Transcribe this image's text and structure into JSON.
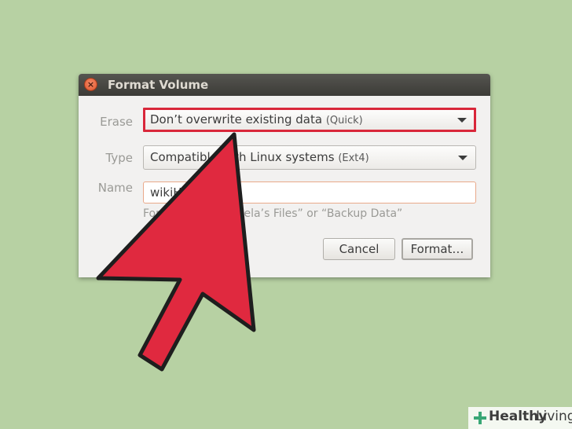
{
  "dialog": {
    "title": "Format Volume",
    "close_icon": "×"
  },
  "form": {
    "erase_label": "Erase",
    "erase_value": "Don’t overwrite existing data",
    "erase_hint": "(Quick)",
    "type_label": "Type",
    "type_value": "Compatible with Linux systems",
    "type_hint": "(Ext4)",
    "name_label": "Name",
    "name_value": "wikiH",
    "name_hint": "For example: “Angela’s Files” or “Backup Data”"
  },
  "buttons": {
    "cancel": "Cancel",
    "format": "Format…"
  },
  "watermark": {
    "part1": "Healthy",
    "part2": "Living"
  },
  "colors": {
    "background": "#b7d1a3",
    "highlight": "#d9273a",
    "arrow": "#e0293f",
    "titlebar": "#3c3b37"
  },
  "icons": [
    "close-icon",
    "dropdown-arrow-icon",
    "pointer-arrow",
    "plus-cross-logo-icon"
  ]
}
